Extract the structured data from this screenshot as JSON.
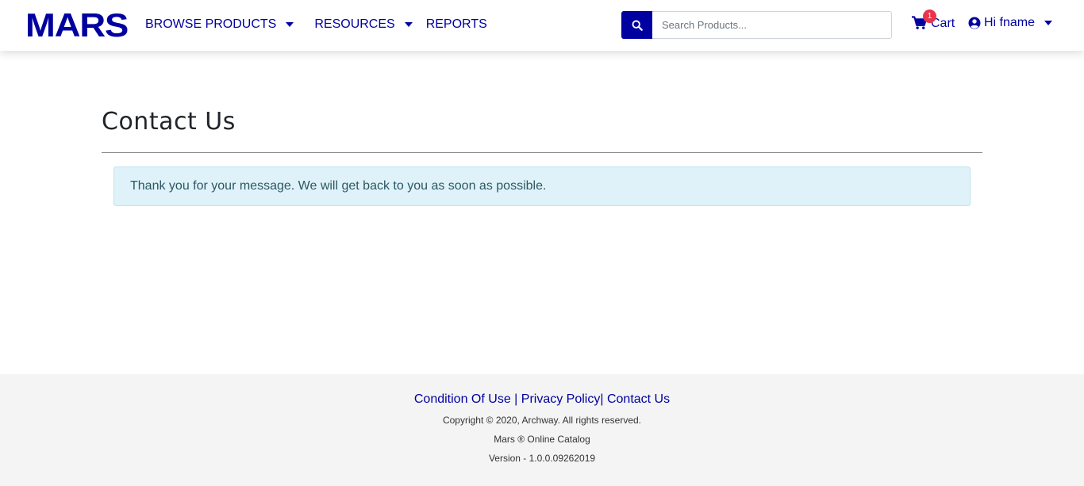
{
  "header": {
    "logo": "MARS",
    "nav": {
      "browse_products": "BROWSE PRODUCTS",
      "resources": "RESOURCES",
      "reports": "REPORTS"
    },
    "search": {
      "placeholder": "Search Products...",
      "value": ""
    },
    "cart": {
      "label": "Cart",
      "count": "1"
    },
    "user": {
      "greeting": "Hi fname"
    }
  },
  "main": {
    "title": "Contact Us",
    "alert": "Thank you for your message. We will get back to you as soon as possible."
  },
  "footer": {
    "links": {
      "condition_of_use": "Condition Of Use",
      "privacy_policy": "Privacy Policy",
      "contact_us": "Contact Us",
      "separator": "|"
    },
    "copyright": "Copyright © 2020, Archway. All rights reserved.",
    "catalog": "Mars ® Online Catalog",
    "version": "Version - 1.0.0.09262019"
  },
  "colors": {
    "brand": "#0000a0",
    "badge": "#e8354b",
    "alert_bg": "#dff2f9",
    "footer_bg": "#f4f4f4"
  },
  "icons": [
    "search-icon",
    "cart-icon",
    "user-circle-icon",
    "chevron-down-icon"
  ]
}
